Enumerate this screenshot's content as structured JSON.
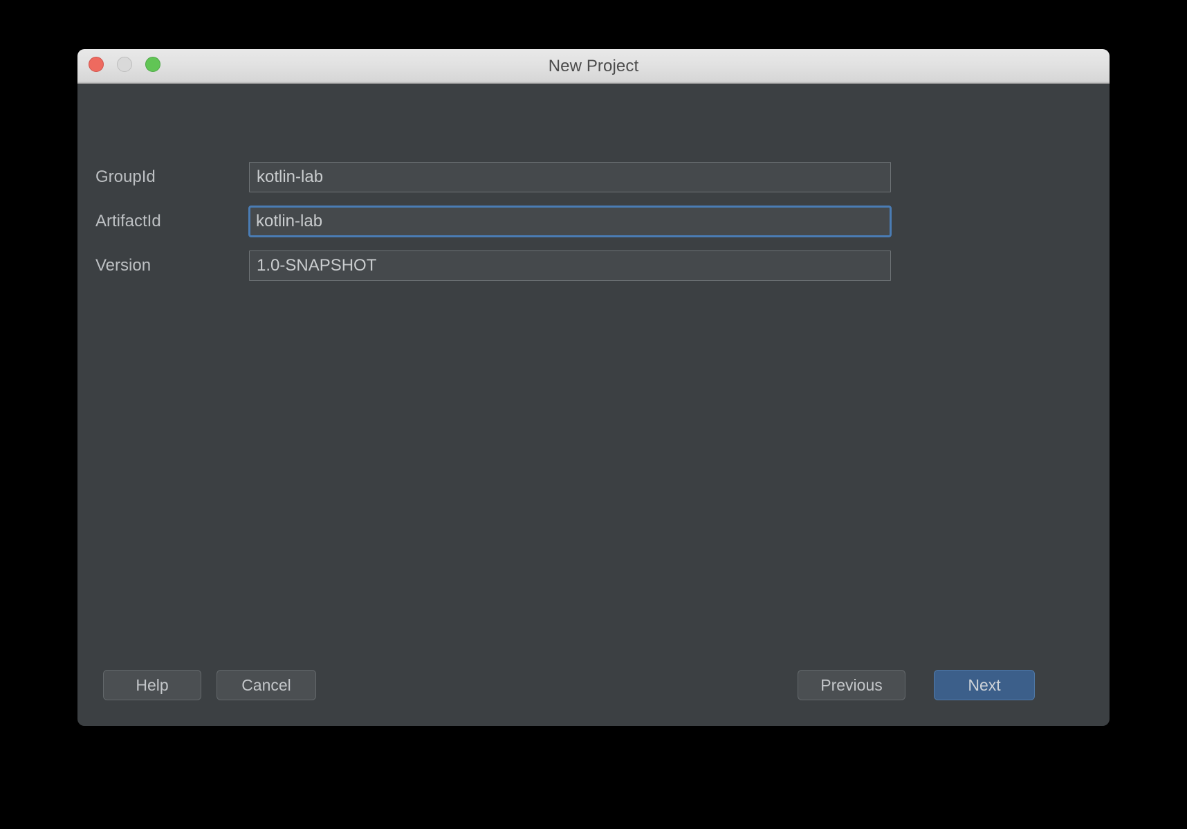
{
  "window": {
    "title": "New Project",
    "traffic_lights": [
      {
        "name": "close",
        "color": "#ee6a5f"
      },
      {
        "name": "minimize",
        "color": "#d9d9d9"
      },
      {
        "name": "maximize",
        "color": "#61c555"
      }
    ]
  },
  "form": {
    "fields": [
      {
        "label": "GroupId",
        "value": "kotlin-lab",
        "placeholder": "",
        "focused": false
      },
      {
        "label": "ArtifactId",
        "value": "kotlin-lab",
        "placeholder": "",
        "focused": true
      },
      {
        "label": "Version",
        "value": "1.0-SNAPSHOT",
        "placeholder": "",
        "focused": false
      }
    ]
  },
  "footer": {
    "help_label": "Help",
    "cancel_label": "Cancel",
    "previous_label": "Previous",
    "next_label": "Next"
  },
  "colors": {
    "dialog_background": "#3c4043",
    "titlebar": "#e2e2e2",
    "field_background": "#45494c",
    "field_border": "#6e7376",
    "focus_border": "#4a7cb4",
    "primary_button": "#3c5f8a",
    "text": "#c9ccce",
    "label_text": "#bdc0c3"
  }
}
